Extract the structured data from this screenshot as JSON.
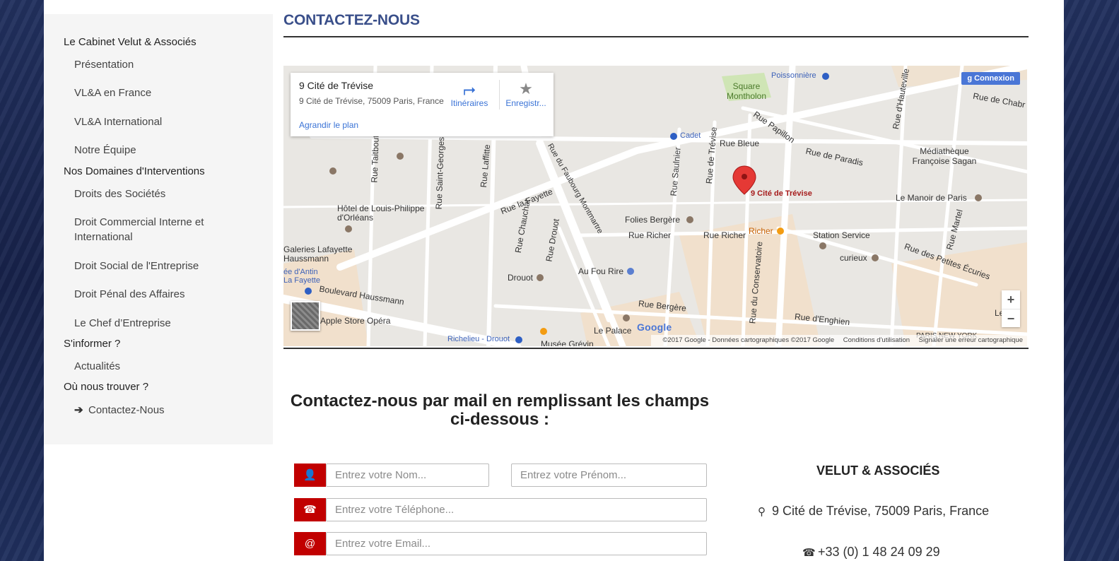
{
  "page": {
    "title": "CONTACTEZ-NOUS"
  },
  "sidebar": {
    "sections": [
      {
        "label": "Le Cabinet Velut & Associés",
        "items": [
          "Présentation",
          "VL&A en France",
          "VL&A International",
          "Notre Équipe"
        ]
      },
      {
        "label": "Nos Domaines d'Interventions",
        "items": [
          "Droits des Sociétés",
          "Droit Commercial Interne et International",
          "Droit Social de l'Entreprise",
          "Droit Pénal des Affaires",
          "Le Chef d’Entreprise"
        ]
      },
      {
        "label": "S'informer ?",
        "items": [
          "Actualités"
        ]
      },
      {
        "label": "Où nous trouver ?",
        "items": [
          "Contactez-Nous"
        ]
      }
    ],
    "active_item": "Contactez-Nous"
  },
  "map": {
    "card": {
      "title": "9 Cité de Trévise",
      "address": "9 Cité de Trévise, 75009 Paris, France",
      "enlarge": "Agrandir le plan",
      "directions": "Itinéraires",
      "save": "Enregistr..."
    },
    "connexion": "Connexion",
    "pin_label": "9 Cité de Trévise",
    "google": "Google",
    "attribution": "©2017 Google - Données cartographiques ©2017 Google",
    "terms": "Conditions d'utilisation",
    "report": "Signaler une erreur cartographique",
    "zoom_in": "+",
    "zoom_out": "−",
    "labels": {
      "poissonniere": "Poissonnière",
      "square_montholon": "Square Montholon",
      "cadet": "Cadet",
      "rue_bleue": "Rue Bleue",
      "rue_papillon": "Rue Papillon",
      "rue_paradis": "Rue de Paradis",
      "mediatheque": "Médiathèque Françoise Sagan",
      "manoir": "Le Manoir de Paris",
      "hotel_louis": "Hôtel de Louis-Philippe d'Orléans",
      "galeries": "Galeries Lafayette Haussmann",
      "folies": "Folies Bergère",
      "rue_richer": "Rue Richer",
      "rue_richer2": "Rue Richer",
      "richer": "Richer",
      "station": "Station Service",
      "curieux": "curieux",
      "au_fou_rire": "Au Fou Rire",
      "drouot": "Drouot",
      "bd_haussmann": "Boulevard Haussmann",
      "apple": "Apple Store Opéra",
      "rue_bergere": "Rue Bergère",
      "rue_enghien": "Rue d'Enghien",
      "le_palace": "Le Palace",
      "richelieu": "Richelieu - Drouot",
      "musee_grevin": "Musée Grévin",
      "les_etoiles": "Les Ét",
      "paris_ny": "PARIS NEW YORK",
      "rue_lafayette": "Rue la Fayette",
      "rue_faubourg": "Rue du Faubourg Montmartre",
      "rue_petites_ecuries": "Rue des Petites Écuries",
      "rue_chabrol": "Rue de Chabr",
      "rue_hauteville": "Rue d'Hauteville",
      "rue_martel": "Rue Martel",
      "rue_trevise": "Rue de Trévise",
      "rue_saulnier": "Rue Saulnier",
      "rue_conservatoire": "Rue du Conservatoire",
      "rue_chauchat": "Rue Chauchat",
      "rue_drouot": "Rue Drouot",
      "rue_laffitte": "Rue Laffitte",
      "rue_st_georges": "Rue Saint-Georges",
      "rue_taitbout": "Rue Taitbout",
      "chaussee_antin": "ée d'Antin",
      "la_fayette": "La Fayette"
    }
  },
  "form": {
    "heading": "Contactez-nous par mail en remplissant les champs ci-dessous :",
    "nom_placeholder": "Entrez votre Nom...",
    "prenom_placeholder": "Entrez votre Prénom...",
    "telephone_placeholder": "Entrez votre Téléphone...",
    "email_placeholder": "Entrez votre Email...",
    "icons": [
      "user-icon",
      "phone-icon",
      "at-icon"
    ]
  },
  "contact": {
    "company": "VELUT & ASSOCIÉS",
    "address": "9 Cité de Trévise, 75009 Paris, France",
    "phone": "+33 (0) 1 48 24 09 29"
  },
  "colors": {
    "accent_red": "#c10000",
    "title_blue": "#3a4f8a",
    "link_blue": "#3a73d6",
    "pin_red": "#e53935"
  }
}
